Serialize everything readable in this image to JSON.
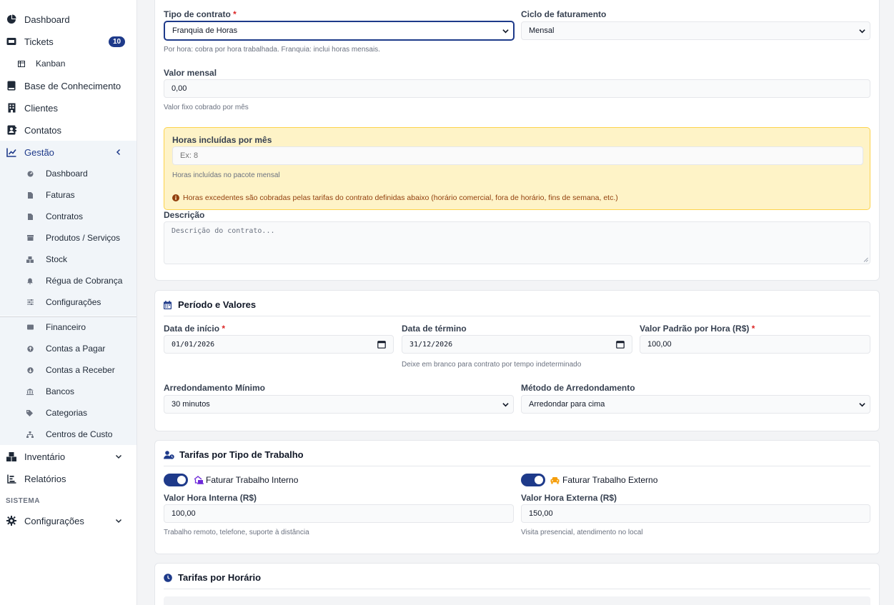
{
  "sidebar": {
    "items": [
      {
        "label": "Dashboard",
        "icon": "gauge-icon"
      },
      {
        "label": "Tickets",
        "icon": "ticket-icon",
        "badge": "10"
      },
      {
        "label": "Kanban",
        "icon": "kanban-icon"
      },
      {
        "label": "Base de Conhecimento",
        "icon": "book-icon"
      },
      {
        "label": "Clientes",
        "icon": "building-icon"
      },
      {
        "label": "Contatos",
        "icon": "address-book-icon"
      },
      {
        "label": "Gestão",
        "icon": "chart-line-icon"
      }
    ],
    "gestao_items": [
      {
        "label": "Dashboard"
      },
      {
        "label": "Faturas"
      },
      {
        "label": "Contratos"
      },
      {
        "label": "Produtos / Serviços"
      },
      {
        "label": "Stock"
      },
      {
        "label": "Régua de Cobrança"
      },
      {
        "label": "Configurações"
      }
    ],
    "financeiro_items": [
      {
        "label": "Financeiro"
      },
      {
        "label": "Contas a Pagar"
      },
      {
        "label": "Contas a Receber"
      },
      {
        "label": "Bancos"
      },
      {
        "label": "Categorias"
      },
      {
        "label": "Centros de Custo"
      }
    ],
    "bottom_items": [
      {
        "label": "Inventário"
      },
      {
        "label": "Relatórios"
      }
    ],
    "section_label": "SISTEMA",
    "config_label": "Configurações"
  },
  "contract": {
    "tipo_label": "Tipo de contrato",
    "tipo_value": "Franquia de Horas",
    "ciclo_label": "Ciclo de faturamento",
    "ciclo_value": "Mensal",
    "tipo_help": "Por hora: cobra por hora trabalhada. Franquia: inclui horas mensais.",
    "valor_label": "Valor mensal",
    "valor_value": "0,00",
    "valor_help": "Valor fixo cobrado por mês",
    "horas_label": "Horas incluídas por mês",
    "horas_placeholder": "Ex: 8",
    "horas_help": "Horas incluídas no pacote mensal",
    "horas_warning": "Horas excedentes são cobradas pelas tarifas do contrato definidas abaixo (horário comercial, fora de horário, fins de semana, etc.)",
    "descricao_label": "Descrição",
    "descricao_placeholder": "Descrição do contrato..."
  },
  "periodo": {
    "title": "Período e Valores",
    "inicio_label": "Data de início",
    "inicio_value": "01/01/2026",
    "termino_label": "Data de término",
    "termino_value": "31/12/2026",
    "termino_help": "Deixe em branco para contrato por tempo indeterminado",
    "valor_hora_label": "Valor Padrão por Hora (R$)",
    "valor_hora_value": "100,00",
    "arred_label": "Arredondamento Mínimo",
    "arred_value": "30 minutos",
    "metodo_label": "Método de Arredondamento",
    "metodo_value": "Arredondar para cima"
  },
  "tarifas": {
    "title": "Tarifas por Tipo de Trabalho",
    "interno_toggle": "Faturar Trabalho Interno",
    "externo_toggle": "Faturar Trabalho Externo",
    "interna_label": "Valor Hora Interna (R$)",
    "interna_value": "100,00",
    "interna_help": "Trabalho remoto, telefone, suporte à distância",
    "externa_label": "Valor Hora Externa (R$)",
    "externa_value": "150,00",
    "externa_help": "Visita presencial, atendimento no local"
  },
  "horario": {
    "title": "Tarifas por Horário"
  },
  "colors": {
    "primary": "#1e3a8a",
    "warning_bg": "#fef3c7",
    "warning_border": "#fcd34d",
    "warning_text": "#92400e",
    "required": "#dc2626"
  }
}
